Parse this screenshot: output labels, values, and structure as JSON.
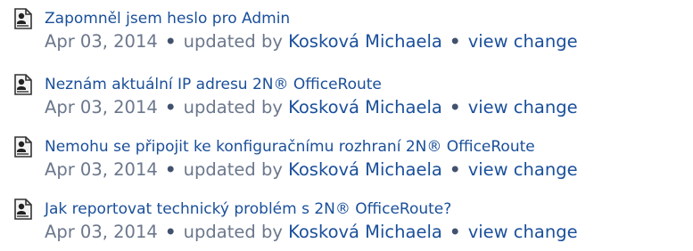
{
  "activity": {
    "items": [
      {
        "title": "Zapomněl jsem heslo pro Admin",
        "date": "Apr 03, 2014",
        "updated_by_label": "updated by",
        "author": "Kosková Michaela",
        "separator": "•",
        "change_link": "view change"
      },
      {
        "title": "Neznám aktuální IP adresu 2N® OfficeRoute",
        "date": "Apr 03, 2014",
        "updated_by_label": "updated by",
        "author": "Kosková Michaela",
        "separator": "•",
        "change_link": "view change"
      },
      {
        "title": "Nemohu se připojit ke konfiguračnímu rozhraní 2N® OfficeRoute",
        "date": "Apr 03, 2014",
        "updated_by_label": "updated by",
        "author": "Kosková Michaela",
        "separator": "•",
        "change_link": "view change"
      },
      {
        "title": "Jak reportovat technický problém s 2N® OfficeRoute?",
        "date": "Apr 03, 2014",
        "updated_by_label": "updated by",
        "author": "Kosková Michaela",
        "separator": "•",
        "change_link": "view change"
      }
    ]
  },
  "icons": {
    "page": "page-document-icon"
  },
  "colors": {
    "link": "#1a4f9a",
    "meta_text": "#6b778c"
  }
}
